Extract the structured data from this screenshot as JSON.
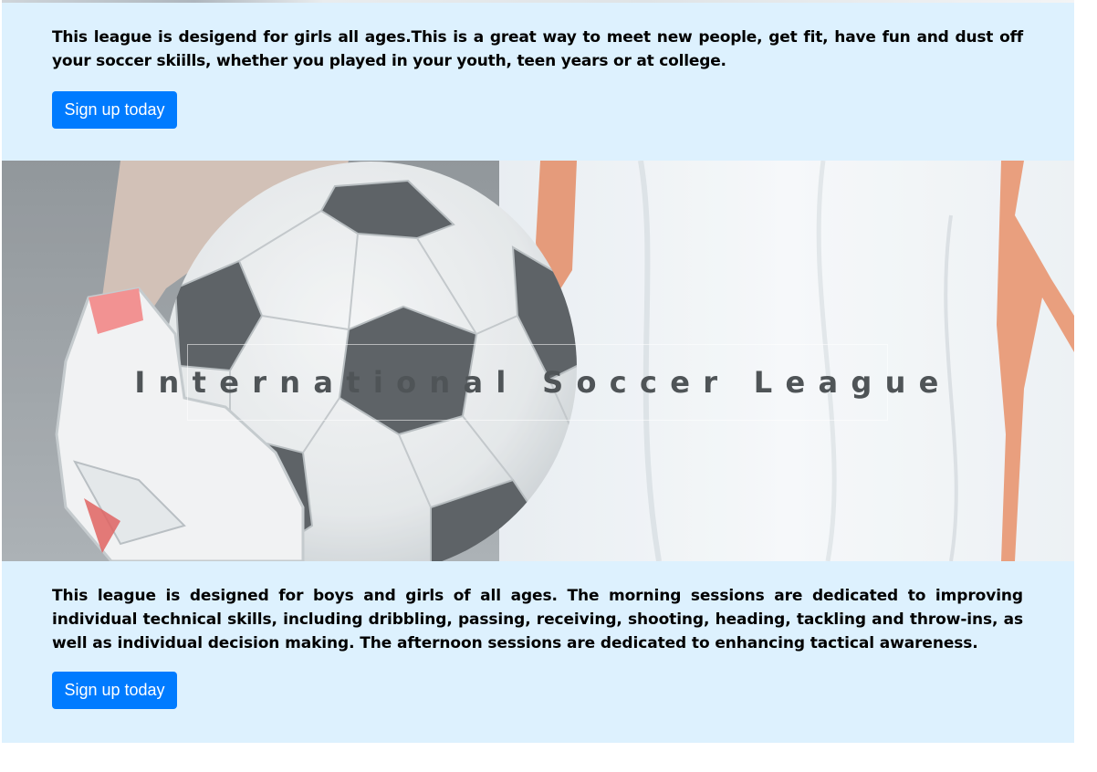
{
  "sections": {
    "girls_league": {
      "description": "This league is desigend for girls all ages.This is a great way to meet new people, get fit, have fun and dust off your soccer skiills, whether you played in your youth, teen years or at college.",
      "button_label": "Sign up today"
    },
    "hero": {
      "title": "International Soccer League",
      "image_subject": "soccer-ball-held-by-goalkeeper-glove"
    },
    "youth_league": {
      "description": "This league is designed for boys and girls of all ages. The morning sessions are dedicated to improving individual technical skills, including dribbling, passing, receiving, shooting, heading, tackling and throw-ins, as well as individual decision making. The afternoon sessions are dedicated to enhancing tactical awareness.",
      "button_label": "Sign up today"
    }
  },
  "colors": {
    "panel_background": "#ddf1fe",
    "button_background": "#007bff",
    "button_text": "#ffffff",
    "hero_title_text": "#4f5457"
  }
}
